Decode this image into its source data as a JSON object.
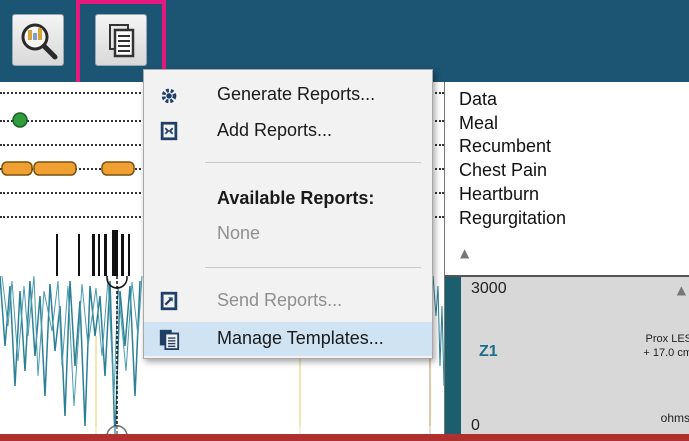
{
  "toolbar": {
    "icons": [
      "analysis-magnifier-icon",
      "reports-document-icon"
    ],
    "colors": {
      "background": "#1c5474",
      "highlight": "#e6197f"
    }
  },
  "menu": {
    "items": [
      {
        "label": "Generate Reports...",
        "icon": "gear-icon",
        "disabled": false
      },
      {
        "label": "Add Reports...",
        "icon": "add-report-icon",
        "disabled": false
      },
      {
        "label": "Send Reports...",
        "icon": "send-report-icon",
        "disabled": true
      },
      {
        "label": "Manage Templates...",
        "icon": "templates-icon",
        "disabled": false,
        "highlighted": true
      }
    ],
    "available_header": "Available Reports:",
    "available_none": "None"
  },
  "events": {
    "items": [
      "Data",
      "Meal",
      "Recumbent",
      "Chest Pain",
      "Heartburn",
      "Regurgitation"
    ]
  },
  "channel": {
    "max": "3000",
    "min": "0",
    "name": "Z1",
    "position_line1": "Prox LES",
    "position_line2": "+ 17.0 cm",
    "unit": "ohms"
  }
}
